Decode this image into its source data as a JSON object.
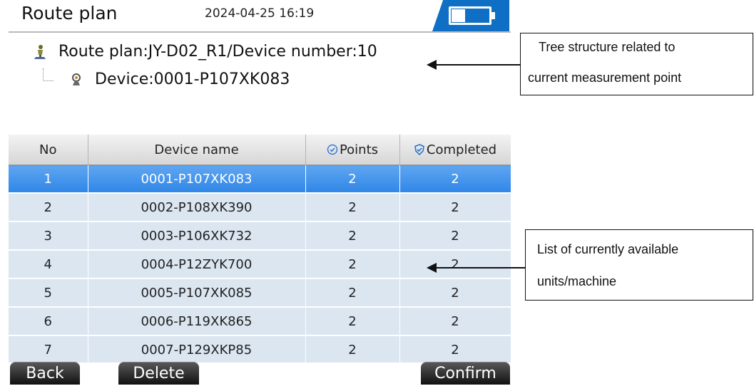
{
  "header": {
    "title": "Route plan",
    "datetime": "2024-04-25 16:19",
    "battery_icon": "battery-icon",
    "accent_color": "#0f6fc4"
  },
  "tree": {
    "root_label": "Route plan:JY-D02_R1/Device number:10",
    "root_icon": "route-plan-icon",
    "child_label": "Device:0001-P107XK083",
    "child_icon": "device-icon"
  },
  "callouts": {
    "tree_note_line1": "Tree structure related to",
    "tree_note_line2": "current measurement point",
    "list_note_line1": "List of currently available",
    "list_note_line2": "units/machine"
  },
  "table": {
    "headers": {
      "no": "No",
      "name": "Device name",
      "points": "Points",
      "completed": "Completed"
    },
    "selected_color": "#2f86e8",
    "row_color": "#dbe6f1",
    "rows": [
      {
        "no": "1",
        "name": "0001-P107XK083",
        "points": "2",
        "completed": "2"
      },
      {
        "no": "2",
        "name": "0002-P108XK390",
        "points": "2",
        "completed": "2"
      },
      {
        "no": "3",
        "name": "0003-P106XK732",
        "points": "2",
        "completed": "2"
      },
      {
        "no": "4",
        "name": "0004-P12ZYK700",
        "points": "2",
        "completed": "2"
      },
      {
        "no": "5",
        "name": "0005-P107XK085",
        "points": "2",
        "completed": "2"
      },
      {
        "no": "6",
        "name": "0006-P119XK865",
        "points": "2",
        "completed": "2"
      },
      {
        "no": "7",
        "name": "0007-P129XKP85",
        "points": "2",
        "completed": "2"
      }
    ]
  },
  "buttons": {
    "back": "Back",
    "delete": "Delete",
    "confirm": "Confirm"
  }
}
